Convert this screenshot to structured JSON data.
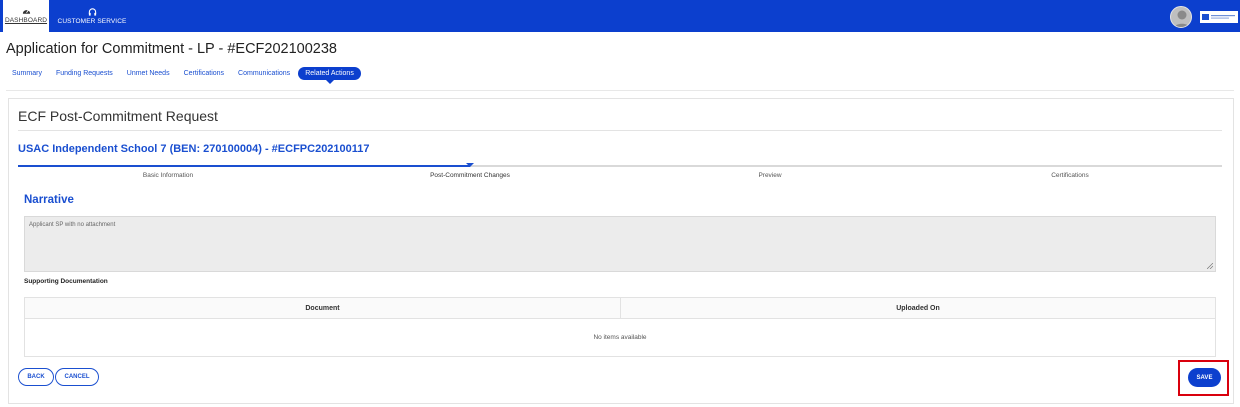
{
  "topnav": {
    "dashboard_label": "DASHBOARD",
    "customer_service_label": "CUSTOMER SERVICE",
    "dashboard_icon": "speedometer-icon",
    "customer_service_icon": "headset-icon",
    "avatar_icon": "user-avatar-icon",
    "logo_icon": "usac-logo"
  },
  "header": {
    "title": "Application for Commitment - LP - #ECF202100238",
    "tabs": [
      {
        "label": "Summary"
      },
      {
        "label": "Funding Requests"
      },
      {
        "label": "Unmet Needs"
      },
      {
        "label": "Certifications"
      },
      {
        "label": "Communications"
      },
      {
        "label": "Related Actions",
        "active": true
      }
    ]
  },
  "card": {
    "title": "ECF Post-Commitment Request",
    "subtitle": "USAC Independent School 7 (BEN: 270100004) - #ECFPC202100117"
  },
  "stepper": {
    "steps": [
      {
        "label": "Basic Information"
      },
      {
        "label": "Post-Commitment Changes",
        "current": true
      },
      {
        "label": "Preview"
      },
      {
        "label": "Certifications"
      }
    ]
  },
  "narrative": {
    "heading": "Narrative",
    "value": "Applicant SP with no attachment"
  },
  "supporting_docs": {
    "label": "Supporting Documentation",
    "columns": [
      "Document",
      "Uploaded On"
    ],
    "empty_text": "No items available"
  },
  "actions": {
    "back_label": "BACK",
    "cancel_label": "CANCEL",
    "save_label": "SAVE"
  },
  "colors": {
    "primary": "#0c3fce",
    "link": "#1a4fd0",
    "highlight": "#d9000d"
  }
}
